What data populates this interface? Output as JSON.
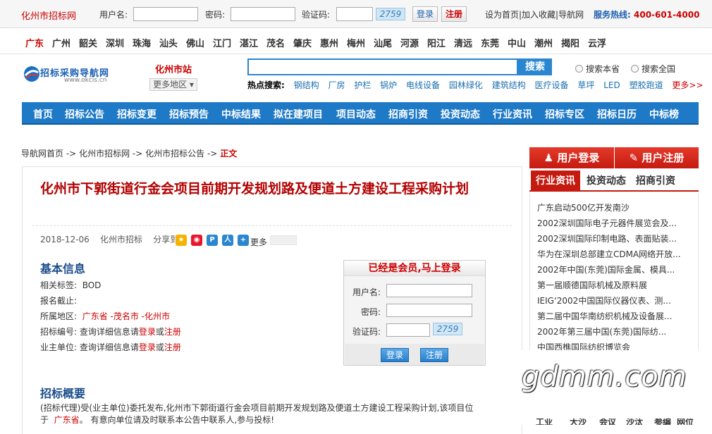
{
  "topbar": {
    "site_name": "化州市招标网",
    "username_label": "用户名:",
    "password_label": "密码:",
    "captcha_label": "验证码:",
    "captcha_code": "2759",
    "login": "登录",
    "register": "注册",
    "links": "设为首页|加入收藏|导航网",
    "hotline_label": "服务热线:",
    "hotline": "400-601-4000"
  },
  "cities": [
    "广东",
    "广州",
    "韶关",
    "深圳",
    "珠海",
    "汕头",
    "佛山",
    "江门",
    "湛江",
    "茂名",
    "肇庆",
    "惠州",
    "梅州",
    "汕尾",
    "河源",
    "阳江",
    "清远",
    "东莞",
    "中山",
    "潮州",
    "揭阳",
    "云浮"
  ],
  "header": {
    "logo_text": "招标采购导航网",
    "logo_url": "www.okcis.cn",
    "station": "化州市站",
    "more_area": "更多地区",
    "search_button": "搜索",
    "radio_site": "搜索本省",
    "radio_all": "搜索全国",
    "hot_label": "热点搜索:",
    "hot_words": [
      "钢结构",
      "厂房",
      "护栏",
      "锅炉",
      "电线设备",
      "园林绿化",
      "建筑结构",
      "医疗设备",
      "草坪",
      "LED",
      "塑胶跑道"
    ],
    "hot_more": "更多>>"
  },
  "nav": [
    "首页",
    "招标公告",
    "招标变更",
    "招标预告",
    "中标结果",
    "拟在建项目",
    "项目动态",
    "招商引资",
    "投资动态",
    "行业资讯",
    "招标专区",
    "招标日历",
    "中标榜"
  ],
  "breadcrumb": {
    "a": "导航网首页",
    "b": "化州市招标网",
    "c": "化州市招标公告",
    "d": "正文",
    "sep": "->"
  },
  "article": {
    "title": "化州市下郭街道行金会项目前期开发规划路及便道土方建设工程采购计划",
    "date": "2018-12-06",
    "source": "化州市招标",
    "share_label": "分享到:",
    "share_more": "更多",
    "basic_title": "基本信息",
    "tag_label": "相关标签:",
    "tag_value": "BOD",
    "deadline_label": "报名截止:",
    "region_label": "所属地区:",
    "region_value": "广东省 -茂名市 -化州市",
    "code_label": "招标编号:",
    "owner_label": "业主单位:",
    "query_text": "查询详细信息请",
    "login_link": "登录",
    "or": "或",
    "register_link": "注册",
    "overview_title": "招标概要",
    "overview_line1": "(招标代理)受(业主单位)委托发布,化州市下郭街道行金会项目前期开发规划路及便道土方建设工程采购计划,该项目位",
    "overview_line2_prefix": "于",
    "overview_region": "广东省",
    "overview_line2_suffix": "。 有意向单位请及时联系本公告中联系人,参与投标!"
  },
  "member_box": {
    "title": "已经是会员,马上登录",
    "username_label": "用户名:",
    "password_label": "密码:",
    "captcha_label": "验证码:",
    "captcha_code": "2759",
    "login": "登录",
    "register": "注册"
  },
  "right": {
    "login": "用户登录",
    "register": "用户注册",
    "tabs": [
      "行业资讯",
      "投资动态",
      "招商引资"
    ],
    "news": [
      "广东启动500亿开发南沙",
      "2002深圳国际电子元器件展览会及...",
      "2002深圳国际印制电路、表面贴装...",
      "华为在深圳总部建立CDMA网络开放...",
      "2002年中国(东莞)国际金属、模具...",
      "第一届顺德国际机械及原料展",
      "IEIG‘2002中国国际仪器仪表、测...",
      "第二届中国华南纺织机械及设备展...",
      "2002年第三届中国(东莞)国际纺...",
      "中国西樵国际纺织博览会"
    ]
  },
  "watermark": "gdmm.com",
  "bottom_strip": [
    "工业",
    "大沙",
    "会议",
    "沙汰",
    "参编",
    "网位"
  ]
}
